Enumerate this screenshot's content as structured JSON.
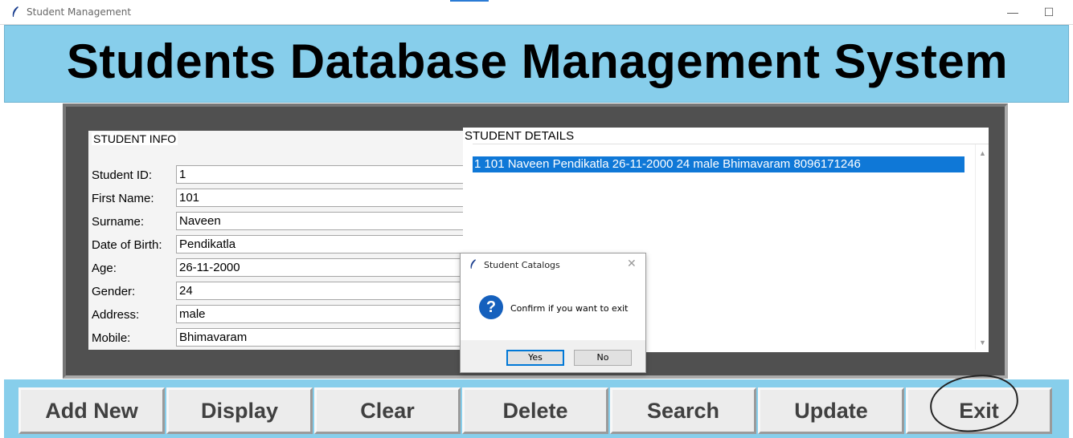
{
  "window": {
    "title": "Student Management",
    "minimize_symbol": "—",
    "maximize_symbol": "☐"
  },
  "banner": {
    "title": "Students Database Management System"
  },
  "student_info": {
    "caption": "STUDENT INFO",
    "fields": [
      {
        "label": "Student ID:",
        "value": "1"
      },
      {
        "label": "First Name:",
        "value": "101"
      },
      {
        "label": "Surname:",
        "value": "Naveen"
      },
      {
        "label": "Date of Birth:",
        "value": "Pendikatla"
      },
      {
        "label": "Age:",
        "value": "26-11-2000"
      },
      {
        "label": "Gender:",
        "value": "24"
      },
      {
        "label": "Address:",
        "value": "male"
      },
      {
        "label": "Mobile:",
        "value": "Bhimavaram"
      }
    ]
  },
  "student_details": {
    "caption": "STUDENT DETAILS",
    "rows": [
      {
        "text": "1 101 Naveen Pendikatla 26-11-2000 24 male Bhimavaram 8096171246",
        "selected": true
      }
    ]
  },
  "dialog": {
    "title": "Student Catalogs",
    "message": "Confirm if you want to exit",
    "icon": "question-icon",
    "icon_glyph": "?",
    "close_symbol": "✕",
    "yes_label": "Yes",
    "no_label": "No"
  },
  "buttons": {
    "add_new": "Add New",
    "display": "Display",
    "clear": "Clear",
    "delete": "Delete",
    "search": "Search",
    "update": "Update",
    "exit": "Exit"
  },
  "colors": {
    "banner_bg": "#87ceeb",
    "frame_bg": "#505050",
    "selection": "#0f78d7",
    "question_icon": "#1560bd"
  }
}
